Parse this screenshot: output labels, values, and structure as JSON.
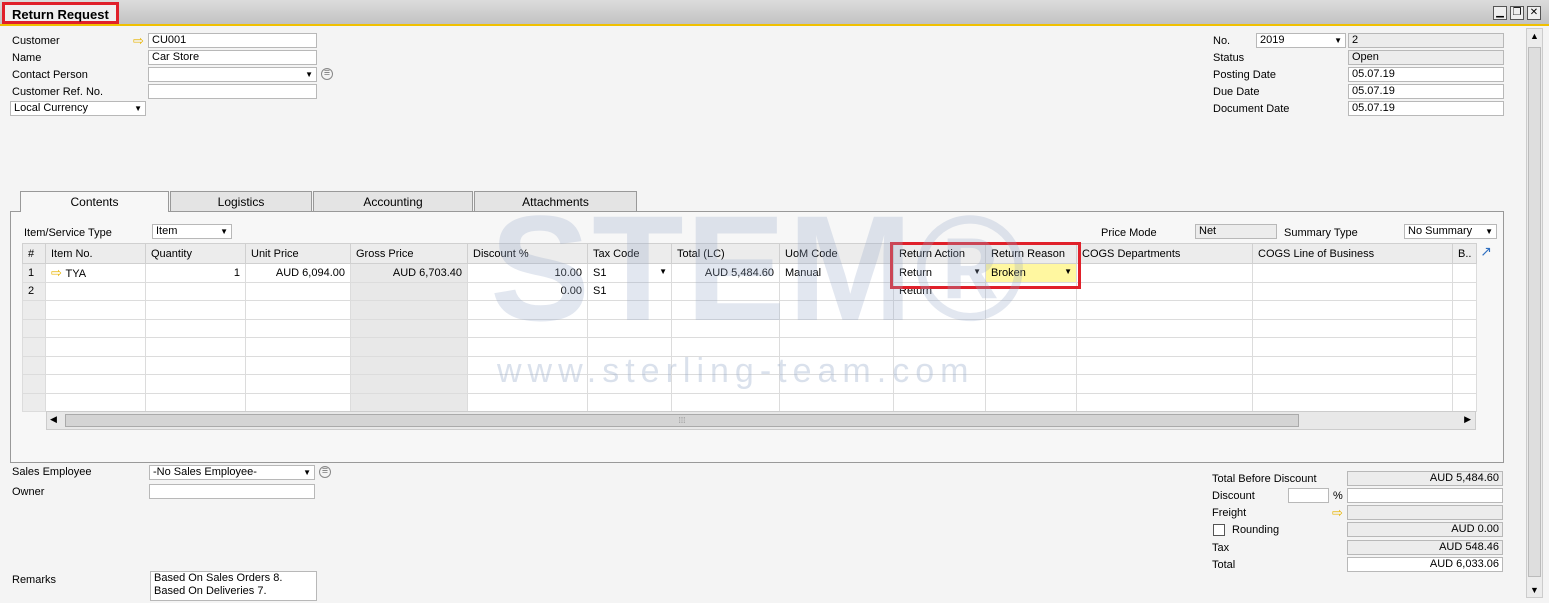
{
  "window": {
    "title": "Return Request"
  },
  "header_left": {
    "customer_label": "Customer",
    "customer_value": "CU001",
    "name_label": "Name",
    "name_value": "Car Store",
    "contact_label": "Contact Person",
    "contact_value": "",
    "ref_label": "Customer Ref. No.",
    "ref_value": "",
    "currency_value": "Local Currency"
  },
  "header_right": {
    "no_label": "No.",
    "no_series": "2019",
    "no_value": "2",
    "status_label": "Status",
    "status_value": "Open",
    "posting_label": "Posting Date",
    "posting_value": "05.07.19",
    "due_label": "Due Date",
    "due_value": "05.07.19",
    "docdate_label": "Document Date",
    "docdate_value": "05.07.19"
  },
  "tabs": [
    {
      "label": "Contents"
    },
    {
      "label": "Logistics"
    },
    {
      "label": "Accounting"
    },
    {
      "label": "Attachments"
    }
  ],
  "contents": {
    "item_type_label": "Item/Service Type",
    "item_type_value": "Item",
    "price_mode_label": "Price Mode",
    "price_mode_value": "Net",
    "summary_label": "Summary Type",
    "summary_value": "No Summary"
  },
  "grid": {
    "columns": [
      "#",
      "Item No.",
      "Quantity",
      "Unit Price",
      "Gross Price",
      "Discount %",
      "Tax Code",
      "Total (LC)",
      "UoM Code",
      "Return Action",
      "Return Reason",
      "COGS Departments",
      "COGS Line of Business",
      "B.."
    ],
    "rows": [
      {
        "num": "1",
        "item": "TYA",
        "qty": "1",
        "unit_price": "AUD 6,094.00",
        "gross_price": "AUD 6,703.40",
        "discount": "10.00",
        "tax": "S1",
        "total": "AUD 5,484.60",
        "uom": "Manual",
        "action": "Return",
        "reason": "Broken"
      },
      {
        "num": "2",
        "item": "",
        "qty": "",
        "unit_price": "",
        "gross_price": "",
        "discount": "0.00",
        "tax": "S1",
        "total": "",
        "uom": "",
        "action": "Return",
        "reason": ""
      }
    ]
  },
  "watermark": {
    "logo": "STEM®",
    "url": "www.sterling-team.com"
  },
  "footer_left": {
    "sales_emp_label": "Sales Employee",
    "sales_emp_value": "-No Sales Employee-",
    "owner_label": "Owner",
    "owner_value": "",
    "remarks_label": "Remarks",
    "remarks_value": "Based On Sales Orders 8. Based On Deliveries 7."
  },
  "totals": {
    "before_discount_label": "Total Before Discount",
    "before_discount_value": "AUD 5,484.60",
    "discount_label": "Discount",
    "discount_pct": "",
    "discount_pct_sign": "%",
    "discount_value": "",
    "freight_label": "Freight",
    "freight_value": "",
    "rounding_label": "Rounding",
    "rounding_value": "AUD 0.00",
    "tax_label": "Tax",
    "tax_value": "AUD 548.46",
    "total_label": "Total",
    "total_value": "AUD 6,033.06"
  }
}
